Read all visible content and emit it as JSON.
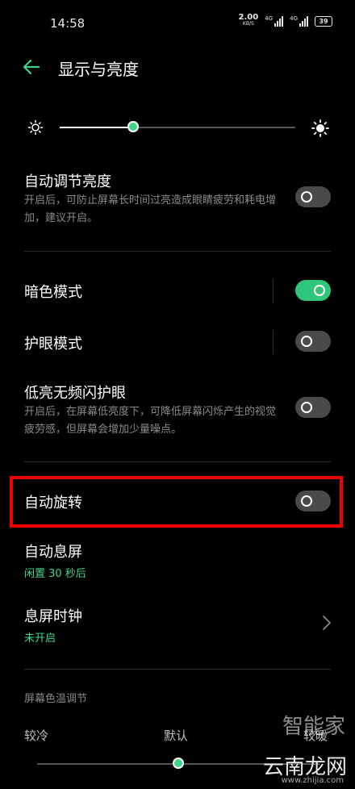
{
  "status_bar": {
    "time": "14:58",
    "net_speed_value": "2.00",
    "net_speed_unit": "KB/S",
    "sim1_label": "4G",
    "sim2_label": "4G",
    "battery": "39"
  },
  "header": {
    "title": "显示与亮度",
    "back_icon": "arrow-left-icon"
  },
  "brightness": {
    "level": 0.31,
    "min_icon": "sun-small-icon",
    "max_icon": "sun-large-icon"
  },
  "settings": {
    "auto_brightness": {
      "label": "自动调节亮度",
      "desc": "开启后，可防止屏幕长时间过亮造成眼睛疲劳和耗电增加，建议开启。",
      "enabled": false
    },
    "dark_mode": {
      "label": "暗色模式",
      "enabled": true
    },
    "eye_protection": {
      "label": "护眼模式",
      "enabled": false
    },
    "low_brightness_dc": {
      "label": "低亮无频闪护眼",
      "desc": "开启后，在屏幕低亮度下，可降低屏幕闪烁产生的视觉疲劳感，但屏幕会增加少量噪点。",
      "enabled": false
    },
    "auto_rotate": {
      "label": "自动旋转",
      "enabled": false
    },
    "screen_timeout": {
      "label": "自动息屏",
      "value": "闲置 30 秒后"
    },
    "aod_clock": {
      "label": "息屏时钟",
      "value": "未开启"
    }
  },
  "color_temp": {
    "section_title": "屏幕色温调节",
    "cool": "较冷",
    "default": "默认",
    "warm": "较暖",
    "level": 0.5
  },
  "watermark": {
    "line1": "智能家",
    "line2": "云南龙网",
    "url": "www.zhijia.com"
  },
  "colors": {
    "accent": "#3ed58a",
    "highlight": "#e00000",
    "background": "#000000"
  }
}
